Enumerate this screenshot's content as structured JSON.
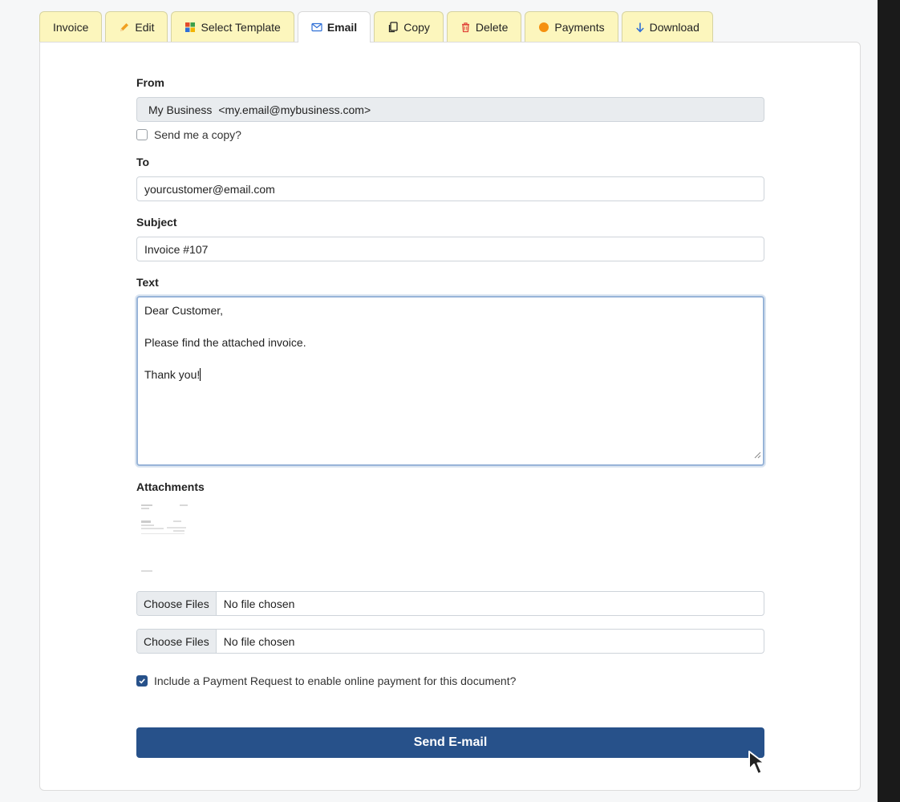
{
  "tabs": [
    {
      "label": "Invoice",
      "icon": "none"
    },
    {
      "label": "Edit",
      "icon": "pencil-icon"
    },
    {
      "label": "Select Template",
      "icon": "grid-icon"
    },
    {
      "label": "Email",
      "icon": "envelope-icon",
      "active": true
    },
    {
      "label": "Copy",
      "icon": "copy-icon"
    },
    {
      "label": "Delete",
      "icon": "trash-icon"
    },
    {
      "label": "Payments",
      "icon": "circle-icon"
    },
    {
      "label": "Download",
      "icon": "arrow-down-icon"
    }
  ],
  "form": {
    "from_label": "From",
    "from_name": "My Business",
    "from_email": "<my.email@mybusiness.com>",
    "send_copy_label": "Send me a copy?",
    "send_copy_checked": false,
    "to_label": "To",
    "to_value": "yourcustomer@email.com",
    "subject_label": "Subject",
    "subject_value": "Invoice #107",
    "text_label": "Text",
    "text_lines": [
      "Dear Customer,",
      "",
      "Please find the attached invoice.",
      "",
      "Thank you!"
    ],
    "attachments_label": "Attachments",
    "file_inputs": [
      {
        "button": "Choose Files",
        "status": "No file chosen"
      },
      {
        "button": "Choose Files",
        "status": "No file chosen"
      }
    ],
    "payment_request_label": "Include a Payment Request to enable online payment for this document?",
    "payment_request_checked": true,
    "send_button": "Send E-mail"
  },
  "colors": {
    "tab_bg": "#fcf6bd",
    "primary": "#27518a",
    "readonly_bg": "#e9ecef"
  }
}
